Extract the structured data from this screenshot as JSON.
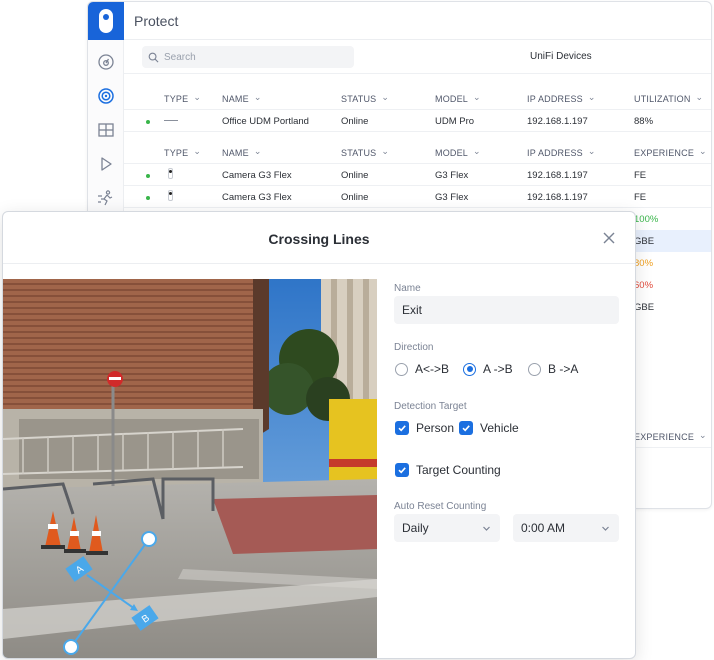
{
  "app": {
    "title": "Protect",
    "search_placeholder": "Search",
    "devices_tab": "UniFi Devices",
    "rail_icons": [
      "dashboard-icon",
      "camera-icon",
      "grid-icon",
      "play-icon",
      "motion-icon"
    ],
    "table1": {
      "headers": [
        "TYPE",
        "NAME",
        "STATUS",
        "MODEL",
        "IP ADDRESS",
        "UTILIZATION"
      ],
      "rows": [
        {
          "name": "Office UDM Portland",
          "status": "Online",
          "model": "UDM Pro",
          "ip": "192.168.1.197",
          "value": "88%"
        }
      ]
    },
    "table2": {
      "headers": [
        "TYPE",
        "NAME",
        "STATUS",
        "MODEL",
        "IP ADDRESS",
        "EXPERIENCE"
      ],
      "rows": [
        {
          "name": "Camera G3 Flex",
          "status": "Online",
          "model": "G3 Flex",
          "ip": "192.168.1.197",
          "value": "FE"
        },
        {
          "name": "Camera G3 Flex",
          "status": "Online",
          "model": "G3 Flex",
          "ip": "192.168.1.197",
          "value": "FE"
        }
      ]
    },
    "partial_values": [
      "100%",
      "GBE",
      "80%",
      "60%",
      "GBE"
    ],
    "partial_colors": [
      "#39b54a",
      "#2b2f36",
      "#f0a020",
      "#e24a3b",
      "#2b2f36"
    ],
    "lower_header": "EXPERIENCE"
  },
  "modal": {
    "title": "Crossing Lines",
    "name_label": "Name",
    "name_value": "Exit",
    "direction_label": "Direction",
    "direction_options": [
      "A<->B",
      "A ->B",
      "B ->A"
    ],
    "direction_selected": "A ->B",
    "detection_label": "Detection Target",
    "detection_person": "Person",
    "detection_vehicle": "Vehicle",
    "target_counting": "Target Counting",
    "auto_reset_label": "Auto Reset Counting",
    "reset_frequency": "Daily",
    "reset_time": "0:00 AM",
    "line_endpoints": [
      "A",
      "B"
    ],
    "accent_color": "#1b6fe0",
    "line_color": "#4aa8ea"
  }
}
